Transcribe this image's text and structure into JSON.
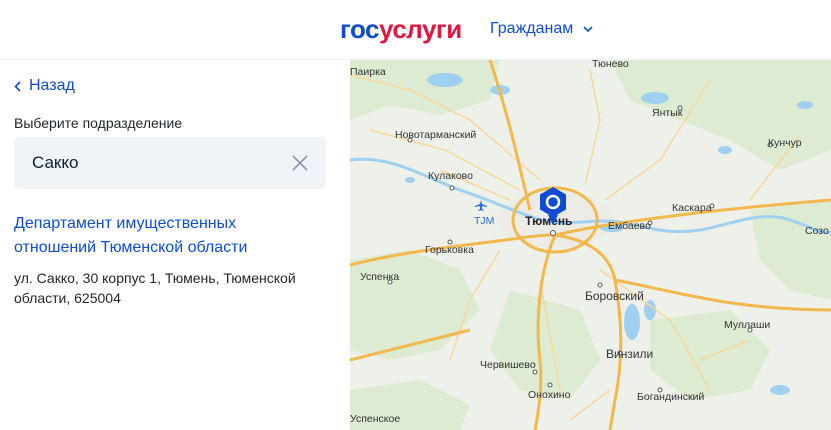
{
  "header": {
    "logo_part1": "гос",
    "logo_part2": "услуги",
    "nav_label": "Гражданам"
  },
  "sidebar": {
    "back_label": "Назад",
    "field_label": "Выберите подразделение",
    "search_value": "Сакко"
  },
  "result": {
    "title": "Департамент имущественных отношений Тюменской области",
    "address": "ул. Сакко, 30 корпус 1, Тюмень, Тюменской области, 625004"
  },
  "map": {
    "labels": {
      "tyumen": "Тюмень",
      "paika": "Паирка",
      "tyuneво": "Тюнево",
      "yantyk": "Янтык",
      "novotarmansky": "Новотарманский",
      "kunchur": "Кунчур",
      "kulakovo": "Кулаково",
      "airport": "TJM",
      "embaevo": "Ембаево",
      "kaskara": "Каскара",
      "sozonovo": "Созо",
      "gorkovka": "Горьковка",
      "uspenka": "Успенка",
      "borovsky": "Боровский",
      "mullashi": "Муллаши",
      "vinzili": "Винзили",
      "chervishevo": "Червишево",
      "onokhino": "Онохино",
      "bogandinsky": "Богандинский",
      "uspenskoe": "Успенское"
    },
    "colors": {
      "major_road": "#f2b84b",
      "minor_road": "#f7d79a",
      "water": "#9fd0f0",
      "forest": "#dcebd1",
      "urban": "#ecebe6",
      "marker": "#0d4cd3"
    }
  }
}
